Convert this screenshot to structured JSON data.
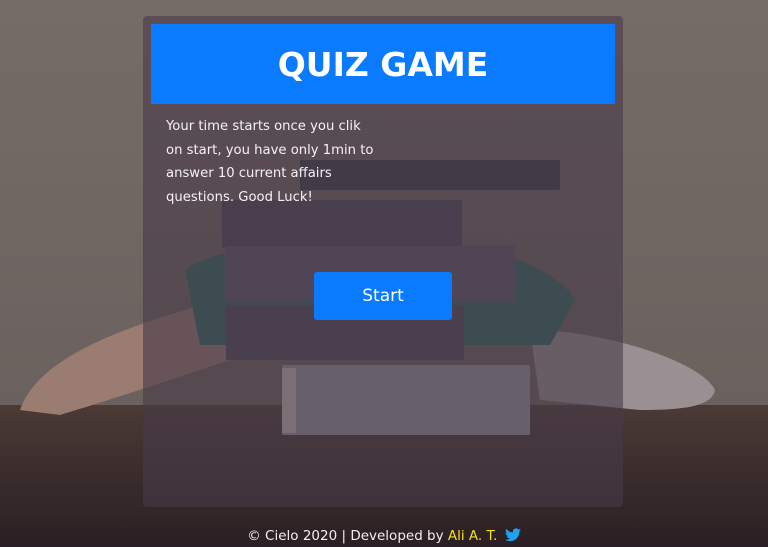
{
  "colors": {
    "header_bg": "#0a7bff",
    "button_bg": "#0a7bff",
    "author_link": "#f5e11b",
    "twitter_blue": "#1da1f2"
  },
  "quiz": {
    "title": "QUIZ GAME",
    "instructions": "Your time starts once you clik on start, you have only 1min to answer 10 current affairs questions. Good Luck!",
    "start_label": "Start"
  },
  "footer": {
    "copyright": "© Cielo 2020 | Developed by ",
    "author": "Ali A. T.",
    "social_icon": "twitter-icon"
  }
}
